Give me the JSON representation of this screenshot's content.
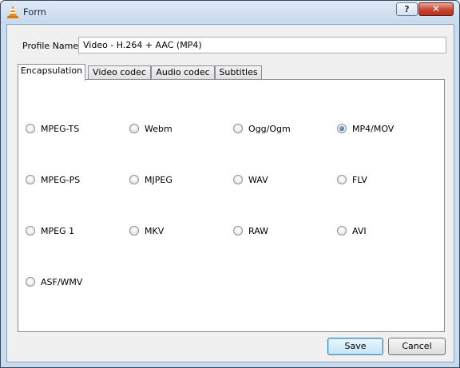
{
  "window": {
    "title": "Form",
    "help_label": "?",
    "close_label": "✕"
  },
  "profile": {
    "label": "Profile Name",
    "value": "Video - H.264 + AAC (MP4)"
  },
  "tabs": [
    {
      "label": "Encapsulation",
      "active": true
    },
    {
      "label": "Video codec",
      "active": false
    },
    {
      "label": "Audio codec",
      "active": false
    },
    {
      "label": "Subtitles",
      "active": false
    }
  ],
  "encapsulation": {
    "options": [
      {
        "label": "MPEG-TS",
        "checked": false
      },
      {
        "label": "Webm",
        "checked": false
      },
      {
        "label": "Ogg/Ogm",
        "checked": false
      },
      {
        "label": "MP4/MOV",
        "checked": true
      },
      {
        "label": "MPEG-PS",
        "checked": false
      },
      {
        "label": "MJPEG",
        "checked": false
      },
      {
        "label": "WAV",
        "checked": false
      },
      {
        "label": "FLV",
        "checked": false
      },
      {
        "label": "MPEG 1",
        "checked": false
      },
      {
        "label": "MKV",
        "checked": false
      },
      {
        "label": "RAW",
        "checked": false
      },
      {
        "label": "AVI",
        "checked": false
      },
      {
        "label": "ASF/WMV",
        "checked": false
      }
    ]
  },
  "buttons": {
    "save": "Save",
    "cancel": "Cancel"
  },
  "icons": {
    "app": "vlc-cone-icon",
    "help": "help-icon",
    "close": "close-icon"
  }
}
